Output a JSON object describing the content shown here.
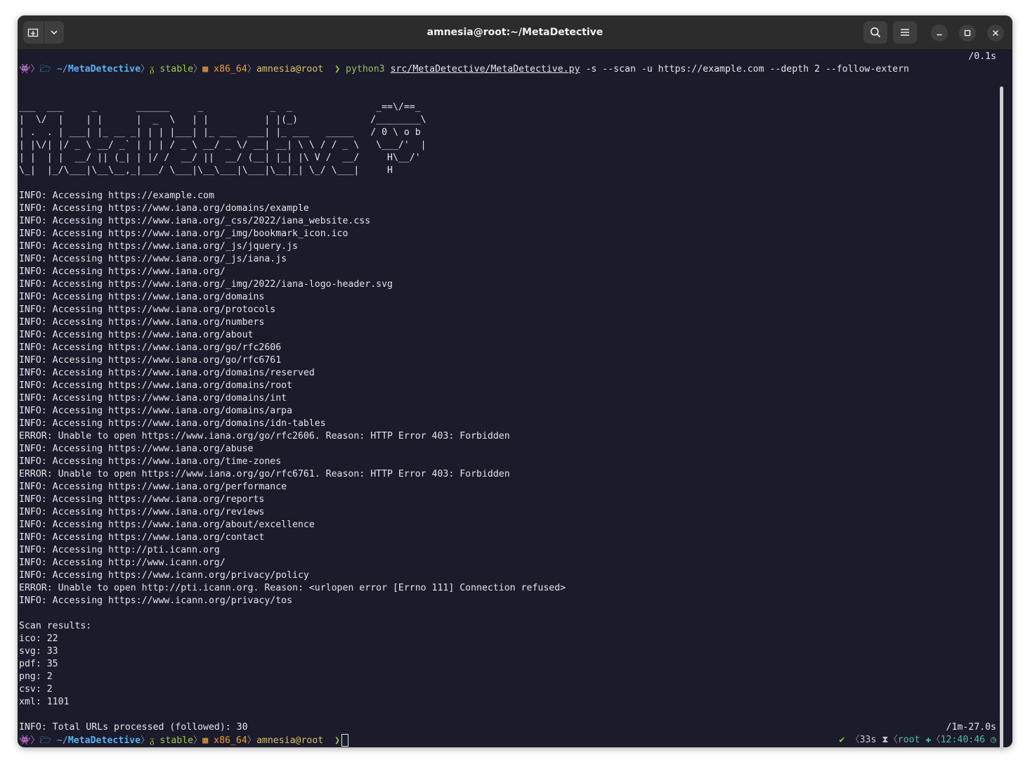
{
  "window": {
    "title": "amnesia@root:~/MetaDetective"
  },
  "icons": {
    "new_tab": "new-tab-icon",
    "dropdown": "chevron-down-icon",
    "search": "search-icon",
    "menu": "hamburger-menu-icon",
    "minimize": "minimize-icon",
    "maximize": "maximize-icon",
    "close": "close-icon"
  },
  "prompt": {
    "os_icon": "👾",
    "sep": "〉",
    "dir_icon": "🗁",
    "dir_prefix": "~/",
    "dir_name": "MetaDetective",
    "git_icon": "ᵹ",
    "branch": "stable",
    "arch_icon": "▦",
    "arch": "x86_64",
    "user": "amnesia@root",
    "arrow": "❯"
  },
  "first_command": {
    "timing": "/0.1s",
    "program": "python3",
    "script": "src/MetaDetective/MetaDetective.py",
    "args": " -s --scan -u https://example.com --depth 2 --follow-extern"
  },
  "banner": [
    "___  ___     _       ______     _            _  _               _==\\/==_",
    "|  \\/  |    | |      |  _  \\   | |          | |(_)             /________\\",
    "| .  . | ___| |_ __ _| | | |___| |_ ___  ___| |_ ___   _____   / 0 \\ o b",
    "| |\\/| |/ _ \\ __/ _` | | | / _ \\ __/ _ \\/ __| __| \\ \\ / / _ \\   \\___/'  |",
    "| |  | |  __/ || (_| | |/ /  __/ ||  __/ (__| |_| |\\ V /  __/     H\\__/'",
    "\\_|  |_/\\___|\\__\\__,_|___/ \\___|\\__\\___|\\___|\\__|_| \\_/ \\___|     H"
  ],
  "log": [
    "INFO: Accessing https://example.com",
    "INFO: Accessing https://www.iana.org/domains/example",
    "INFO: Accessing https://www.iana.org/_css/2022/iana_website.css",
    "INFO: Accessing https://www.iana.org/_img/bookmark_icon.ico",
    "INFO: Accessing https://www.iana.org/_js/jquery.js",
    "INFO: Accessing https://www.iana.org/_js/iana.js",
    "INFO: Accessing https://www.iana.org/",
    "INFO: Accessing https://www.iana.org/_img/2022/iana-logo-header.svg",
    "INFO: Accessing https://www.iana.org/domains",
    "INFO: Accessing https://www.iana.org/protocols",
    "INFO: Accessing https://www.iana.org/numbers",
    "INFO: Accessing https://www.iana.org/about",
    "INFO: Accessing https://www.iana.org/go/rfc2606",
    "INFO: Accessing https://www.iana.org/go/rfc6761",
    "INFO: Accessing https://www.iana.org/domains/reserved",
    "INFO: Accessing https://www.iana.org/domains/root",
    "INFO: Accessing https://www.iana.org/domains/int",
    "INFO: Accessing https://www.iana.org/domains/arpa",
    "INFO: Accessing https://www.iana.org/domains/idn-tables",
    "ERROR: Unable to open https://www.iana.org/go/rfc2606. Reason: HTTP Error 403: Forbidden",
    "INFO: Accessing https://www.iana.org/abuse",
    "INFO: Accessing https://www.iana.org/time-zones",
    "ERROR: Unable to open https://www.iana.org/go/rfc6761. Reason: HTTP Error 403: Forbidden",
    "INFO: Accessing https://www.iana.org/performance",
    "INFO: Accessing https://www.iana.org/reports",
    "INFO: Accessing https://www.iana.org/reviews",
    "INFO: Accessing https://www.iana.org/about/excellence",
    "INFO: Accessing https://www.iana.org/contact",
    "INFO: Accessing http://pti.icann.org",
    "INFO: Accessing http://www.icann.org/",
    "INFO: Accessing https://www.icann.org/privacy/policy",
    "ERROR: Unable to open http://pti.icann.org. Reason: <urlopen error [Errno 111] Connection refused>",
    "INFO: Accessing https://www.icann.org/privacy/tos"
  ],
  "scan_results": {
    "header": "Scan results:",
    "lines": [
      "ico: 22",
      "svg: 33",
      "pdf: 35",
      "png: 2",
      "csv: 2",
      "xml: 1101"
    ]
  },
  "summary": {
    "text": "INFO: Total URLs processed (followed): 30",
    "timing": "/1m-27.0s"
  },
  "right_prompt": {
    "check": "✔",
    "sep": "〈",
    "duration": "33s",
    "hourglass": "⧗",
    "user": "root",
    "user_icon": "✚",
    "time": "12:40:46",
    "clock_icon": "◷"
  },
  "colors": {
    "terminal_bg": "#1c1b2b",
    "titlebar_bg": "#2c2c2c",
    "prompt_dir": "#58b2f2",
    "prompt_branch": "#9ccc44",
    "prompt_arch": "#e7a23a",
    "prompt_user": "#d6c06a",
    "right_prompt": "#4fc1a3"
  }
}
